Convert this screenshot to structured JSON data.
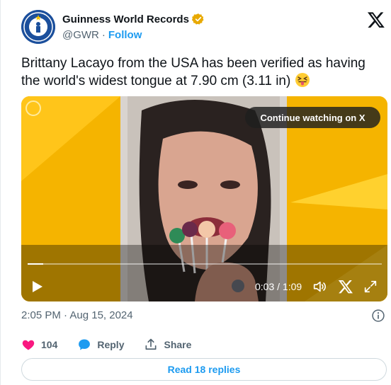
{
  "account": {
    "name": "Guinness World Records",
    "handle": "@GWR",
    "separator": "·",
    "follow_label": "Follow",
    "verified_badge_color": "#e8a900"
  },
  "tweet": {
    "text": "Brittany Lacayo from the USA has been verified as having the world's widest tongue at 7.90 cm (3.11 in)",
    "emoji": "squinting-face-with-tongue",
    "timestamp": "2:05 PM · Aug 15, 2024"
  },
  "video": {
    "continue_label": "Continue watching on X",
    "time_display": "0:03 / 1:09",
    "progress_fraction": 0.043,
    "background_color": "#f5b400"
  },
  "actions": {
    "likes_count": "104",
    "reply_label": "Reply",
    "share_label": "Share",
    "like_color": "#f91880",
    "reply_color": "#1d9bf0"
  },
  "read_replies_label": "Read 18 replies",
  "icons": [
    "x-logo-icon",
    "verified-badge-icon",
    "play-icon",
    "volume-icon",
    "x-small-icon",
    "fullscreen-icon",
    "info-icon",
    "heart-icon",
    "reply-bubble-icon",
    "share-icon"
  ]
}
